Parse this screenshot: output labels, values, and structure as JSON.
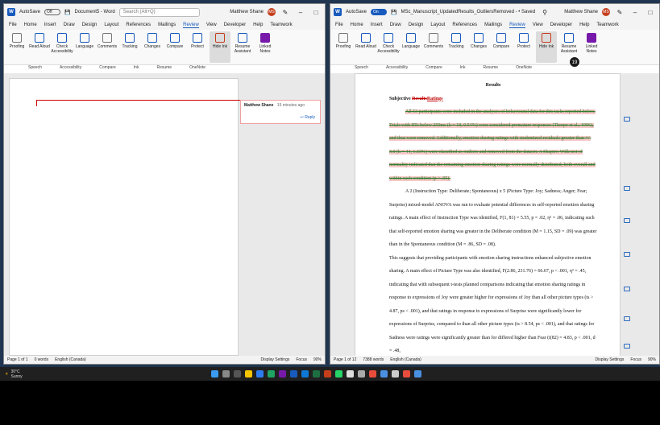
{
  "left_window": {
    "autosave_label": "AutoSave",
    "autosave_state": "Off",
    "doc_title": "Document5 - Word",
    "search_placeholder": "Search (Alt+Q)",
    "user_name": "Matthew Shane",
    "user_initials": "MS",
    "menu": [
      "File",
      "Home",
      "Insert",
      "Draw",
      "Design",
      "Layout",
      "References",
      "Mailings",
      "Review",
      "View",
      "Developer",
      "Help",
      "Teamwork"
    ],
    "active_menu": "Review",
    "ribbon": [
      "Proofing",
      "Read Aloud",
      "Check Accessibility",
      "Language",
      "Comments",
      "Tracking",
      "Changes",
      "Compare",
      "Protect",
      "Hide Ink",
      "Resume Assistant",
      "Linked Notes"
    ],
    "groups": [
      "Speech",
      "Accessibility",
      "Compare",
      "Ink",
      "Resume",
      "OneNote"
    ],
    "comment_author": "Matthew Shane",
    "comment_time": "15 minutes ago",
    "reply_label": "Reply",
    "status": [
      "Page 1 of 1",
      "0 words",
      "English (Canada)",
      "Display Settings",
      "Focus",
      "90%"
    ]
  },
  "right_window": {
    "autosave_label": "AutoSave",
    "autosave_state": "On",
    "doc_title": "MSc_Manuscript_UpdatedResults_OutliersRemoved - • Saved",
    "user_name": "Matthew Shane",
    "user_initials": "MS",
    "menu": [
      "File",
      "Home",
      "Insert",
      "Draw",
      "Design",
      "Layout",
      "References",
      "Mailings",
      "Review",
      "View",
      "Developer",
      "Help",
      "Teamwork"
    ],
    "active_menu": "Review",
    "ribbon": [
      "Proofing",
      "Read Aloud",
      "Check Accessibility",
      "Language",
      "Comments",
      "Tracking",
      "Changes",
      "Compare",
      "Protect",
      "Hide Ink",
      "Resume Assistant",
      "Linked Notes"
    ],
    "groups": [
      "Speech",
      "Accessibility",
      "Compare",
      "Ink",
      "Resume",
      "OneNote"
    ],
    "badge": "19",
    "heading": "Results",
    "subheading_start": "Subjective ",
    "subheading_del": "Results",
    "subheading_ins": "Ratings",
    "para1": "All 53 participants were included in the analyses of behavioural data for this tasks reported below. Trials with RTs below 250ms (k = 18, 0.54%) were considered premature responses (Thorpe et al., 1996), and thus were removed. Additionally, emotion sharing ratings with studentized residuals greater than +/- 3.0 (k = 44, 1.33%) were classified as outliers and removed from the dataset. A Shapiro-Wilk test of normality indicated that the remaining emotion sharing ratings were normally distributed, both overall and within each condition (p > .05).",
    "para2": "A 2 (Instruction Type: Deliberate; Spontaneous) x 5 (Picture Type: Joy; Sadness; Anger; Fear; Surprise) mixed-model ANOVA was run to evaluate potential differences in self-reported emotion sharing ratings. A main effect of Instruction Type was identified, F(1, 81) = 5.55, p = .02, η² = .06, indicating such that self-reported emotion sharing was greater in the Deliberate condition (M = 1.15, SD = .09) was greater than in the Spontaneous condition (M = .86, SD = .08).",
    "para3": "This suggests that providing participants with emotion sharing instructions enhanced subjective emotion sharing. A main effect of Picture Type was also identified, F(2.86, 231.76) = 66.67, p < .001, η² = .45, indicating that with subsequent t-tests planned comparisons indicating that emotion sharing ratings in response to expressions of Joy were greater higher for expressions of Joy than all other picture types (ts > 4.87, ps < .001), and that ratings in response to expressions of Surprise were significantly lower for expressions of Surprise, compared to than all other picture types (ts > 8.54, ps < .001), and that ratings for Sadness were ratings were significantly greater than for differed higher than Fear (t(82) = 4.83, p < .001, d = .48,",
    "status": [
      "Page 1 of 12",
      "7388 words",
      "English (Canada)",
      "Display Settings",
      "Focus",
      "90%"
    ]
  },
  "taskbar": {
    "weather_temp": "30°C",
    "weather_desc": "Sunny"
  },
  "colors": {
    "word_blue": "#185abd",
    "track_red": "#c00000",
    "avatar": "#c43e1c"
  }
}
